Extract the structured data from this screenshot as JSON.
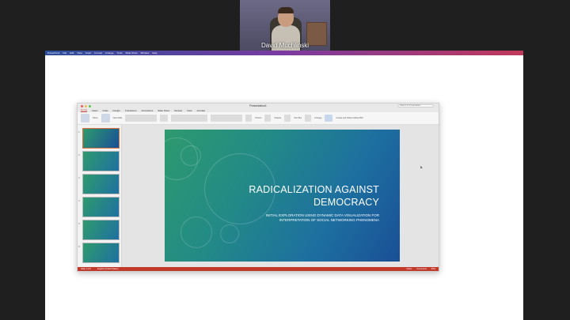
{
  "participant": {
    "name": "David Muchlinski"
  },
  "mac_menu": [
    "PowerPoint",
    "File",
    "Edit",
    "View",
    "Insert",
    "Format",
    "Arrange",
    "Tools",
    "Slide Show",
    "Window",
    "Help"
  ],
  "window": {
    "title": "Presentation1",
    "search_placeholder": "Search in Presentation"
  },
  "ribbon_tabs": [
    {
      "label": "Home",
      "active": true
    },
    {
      "label": "Insert"
    },
    {
      "label": "Draw"
    },
    {
      "label": "Design"
    },
    {
      "label": "Transitions"
    },
    {
      "label": "Animations"
    },
    {
      "label": "Slide Show"
    },
    {
      "label": "Review"
    },
    {
      "label": "View"
    },
    {
      "label": "Acrobat"
    }
  ],
  "ribbon_labels": {
    "paste": "Paste",
    "new_slide": "New Slide",
    "picture": "Picture",
    "shapes": "Shapes",
    "text_box": "Text Box",
    "arrange": "Arrange",
    "create_share": "Create and Share Adobe PDF"
  },
  "thumbnails": [
    "1",
    "2",
    "3",
    "4",
    "5",
    "6"
  ],
  "slide": {
    "title": "RADICALIZATION AGAINST DEMOCRACY",
    "subtitle": "INITIAL EXPLORATION USING DYNAMIC DATA VISUALIZATION FOR INTERPRETATION OF SOCIAL NETWORKING PHENOMENA"
  },
  "status": {
    "slide_info": "Slide 1 of 6",
    "language": "English (United States)",
    "notes": "Notes",
    "comments": "Comments",
    "zoom": "85%"
  },
  "colors": {
    "accent": "#c0392b",
    "slide_gradient_start": "#2e9a6e",
    "slide_gradient_end": "#1a4f96"
  }
}
